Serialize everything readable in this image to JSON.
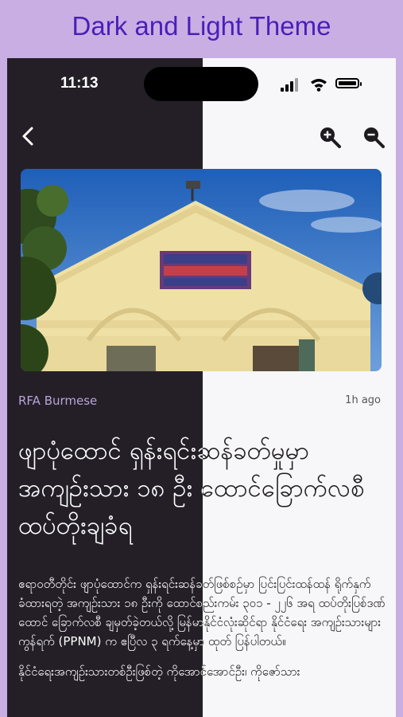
{
  "promo": {
    "title": "Dark and Light Theme"
  },
  "status_bar": {
    "time": "11:13"
  },
  "article": {
    "source": "RFA Burmese",
    "time_ago": "1h ago",
    "headline": "ဖျာပုံထောင် ရှန်းရင်းဆန်ခတ်မှုမှာ အကျဉ်းသား ၁၈ ဦး ထောင်ခြောက်လစီ ထပ်တိုးချခံရ",
    "paragraphs": [
      "ဧရာဝတီတိုင်း ဖျာပုံထောင်က ရှန်းရင်းဆန်ခတ်ဖြစ်စဉ်မှာ ပြင်းပြင်းထန်ထန် ရိုက်နှက်ခံထားရတဲ့ အကျဉ်းသား ၁၈ ဦးကို ထောင်စည်းကမ်း ၃၀၁ - ၂၂၆ အရ ထပ်တိုးပြစ်ဒဏ် ထောင် ခြောက်လစီ ချမှတ်ခဲ့တယ်လို့ မြန်မာနိုင်ငံလုံးဆိုင်ရာ နိုင်ငံရေး အကျဉ်းသားများကွန်ရက် (PPNM) က ဧပြီလ ၃ ရက်နေ့မှာ ထုတ် ပြန်ပါတယ်။",
      "နိုင်ငံရေးအကျဉ်းသားတစ်ဦးဖြစ်တဲ့ ကိုအောင်အောင်ဦး၊ ကိုဇော်သား"
    ]
  }
}
